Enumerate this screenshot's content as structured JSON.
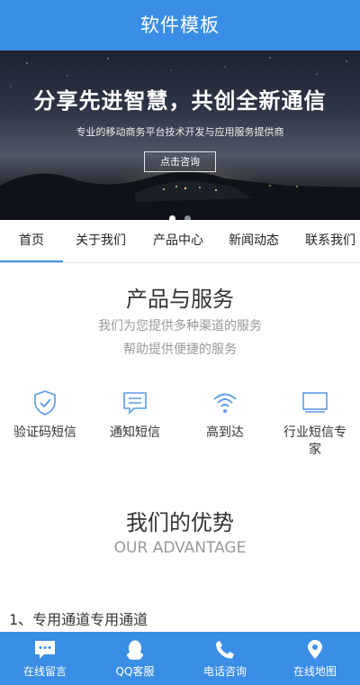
{
  "header": {
    "title": "软件模板"
  },
  "banner": {
    "title": "分享先进智慧，共创全新通信",
    "subtitle": "专业的移动商务平台技术开发与应用服务提供商",
    "cta_label": "点击咨询",
    "slide_count": 2,
    "active_slide": 1
  },
  "nav": {
    "tabs": [
      {
        "label": "首页",
        "active": true
      },
      {
        "label": "关于我们"
      },
      {
        "label": "产品中心"
      },
      {
        "label": "新闻动态"
      },
      {
        "label": "联系我们"
      }
    ]
  },
  "products": {
    "title": "产品与服务",
    "desc_line1": "我们为您提供多种渠道的服务",
    "desc_line2": "帮助提供便捷的服务",
    "items": [
      {
        "label": "验证码短信",
        "icon": "shield-check-icon"
      },
      {
        "label": "通知短信",
        "icon": "message-icon"
      },
      {
        "label": "高到达",
        "icon": "wifi-icon"
      },
      {
        "label": "行业短信专家",
        "icon": "monitor-icon"
      }
    ]
  },
  "advantage": {
    "title": "我们的优势",
    "subtitle": "OUR ADVANTAGE",
    "items": [
      "1、专用通道专用通道"
    ]
  },
  "footer": {
    "items": [
      {
        "label": "在线留言",
        "icon": "chat-bubble-icon"
      },
      {
        "label": "QQ客服",
        "icon": "qq-icon"
      },
      {
        "label": "电话咨询",
        "icon": "phone-icon"
      },
      {
        "label": "在线地图",
        "icon": "map-pin-icon"
      }
    ]
  },
  "colors": {
    "brand": "#3a8ee6",
    "icon_accent": "#5b9be8"
  }
}
